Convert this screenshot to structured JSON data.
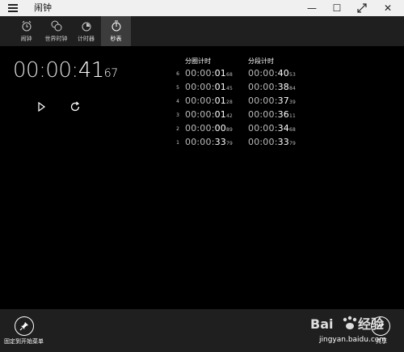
{
  "window": {
    "title": "闹钟",
    "min": "—",
    "max": "☐",
    "close": "✕"
  },
  "tabs": [
    {
      "label": "闹钟",
      "icon": "alarm-icon"
    },
    {
      "label": "世界时钟",
      "icon": "world-clock-icon"
    },
    {
      "label": "计时器",
      "icon": "timer-icon"
    },
    {
      "label": "秒表",
      "icon": "stopwatch-icon",
      "active": true
    }
  ],
  "stopwatch": {
    "time_main": "00:00:",
    "time_seconds": "41",
    "time_centiseconds": "67"
  },
  "laps": {
    "header_lap": "分圈计时",
    "header_split": "分段计时",
    "rows": [
      {
        "no": "6",
        "lap_main": "00:00:",
        "lap_s": "01",
        "lap_cs": "68",
        "split_main": "00:00:",
        "split_s": "40",
        "split_cs": "53"
      },
      {
        "no": "5",
        "lap_main": "00:00:",
        "lap_s": "01",
        "lap_cs": "45",
        "split_main": "00:00:",
        "split_s": "38",
        "split_cs": "84"
      },
      {
        "no": "4",
        "lap_main": "00:00:",
        "lap_s": "01",
        "lap_cs": "28",
        "split_main": "00:00:",
        "split_s": "37",
        "split_cs": "39"
      },
      {
        "no": "3",
        "lap_main": "00:00:",
        "lap_s": "01",
        "lap_cs": "42",
        "split_main": "00:00:",
        "split_s": "36",
        "split_cs": "11"
      },
      {
        "no": "2",
        "lap_main": "00:00:",
        "lap_s": "00",
        "lap_cs": "89",
        "split_main": "00:00:",
        "split_s": "34",
        "split_cs": "68"
      },
      {
        "no": "1",
        "lap_main": "00:00:",
        "lap_s": "33",
        "lap_cs": "79",
        "split_main": "00:00:",
        "split_s": "33",
        "split_cs": "79"
      }
    ]
  },
  "bottom": {
    "pin_label": "固定到开始菜单",
    "share_label": "共享"
  },
  "watermark": {
    "text": "jingyan.baidu.com"
  }
}
